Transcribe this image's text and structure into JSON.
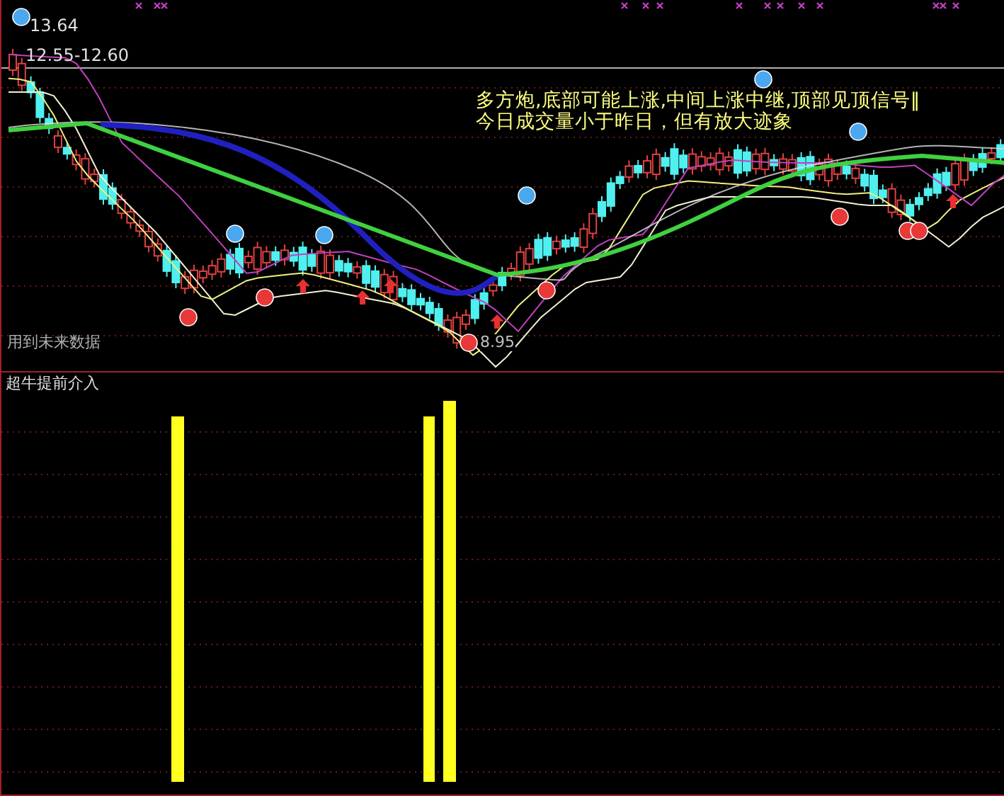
{
  "price_panel": {
    "high_label": "13.64",
    "range_label": "12.55-12.60",
    "signal_lines": [
      "多方炮,底部可能上涨,中间上涨中继,顶部见顶信号‖",
      "今日成交量小于昨日，但有放大迹象"
    ],
    "future_data_note": "用到未来数据",
    "low_label": "8.95"
  },
  "indicator_panel": {
    "title": "超牛提前介入"
  }
}
